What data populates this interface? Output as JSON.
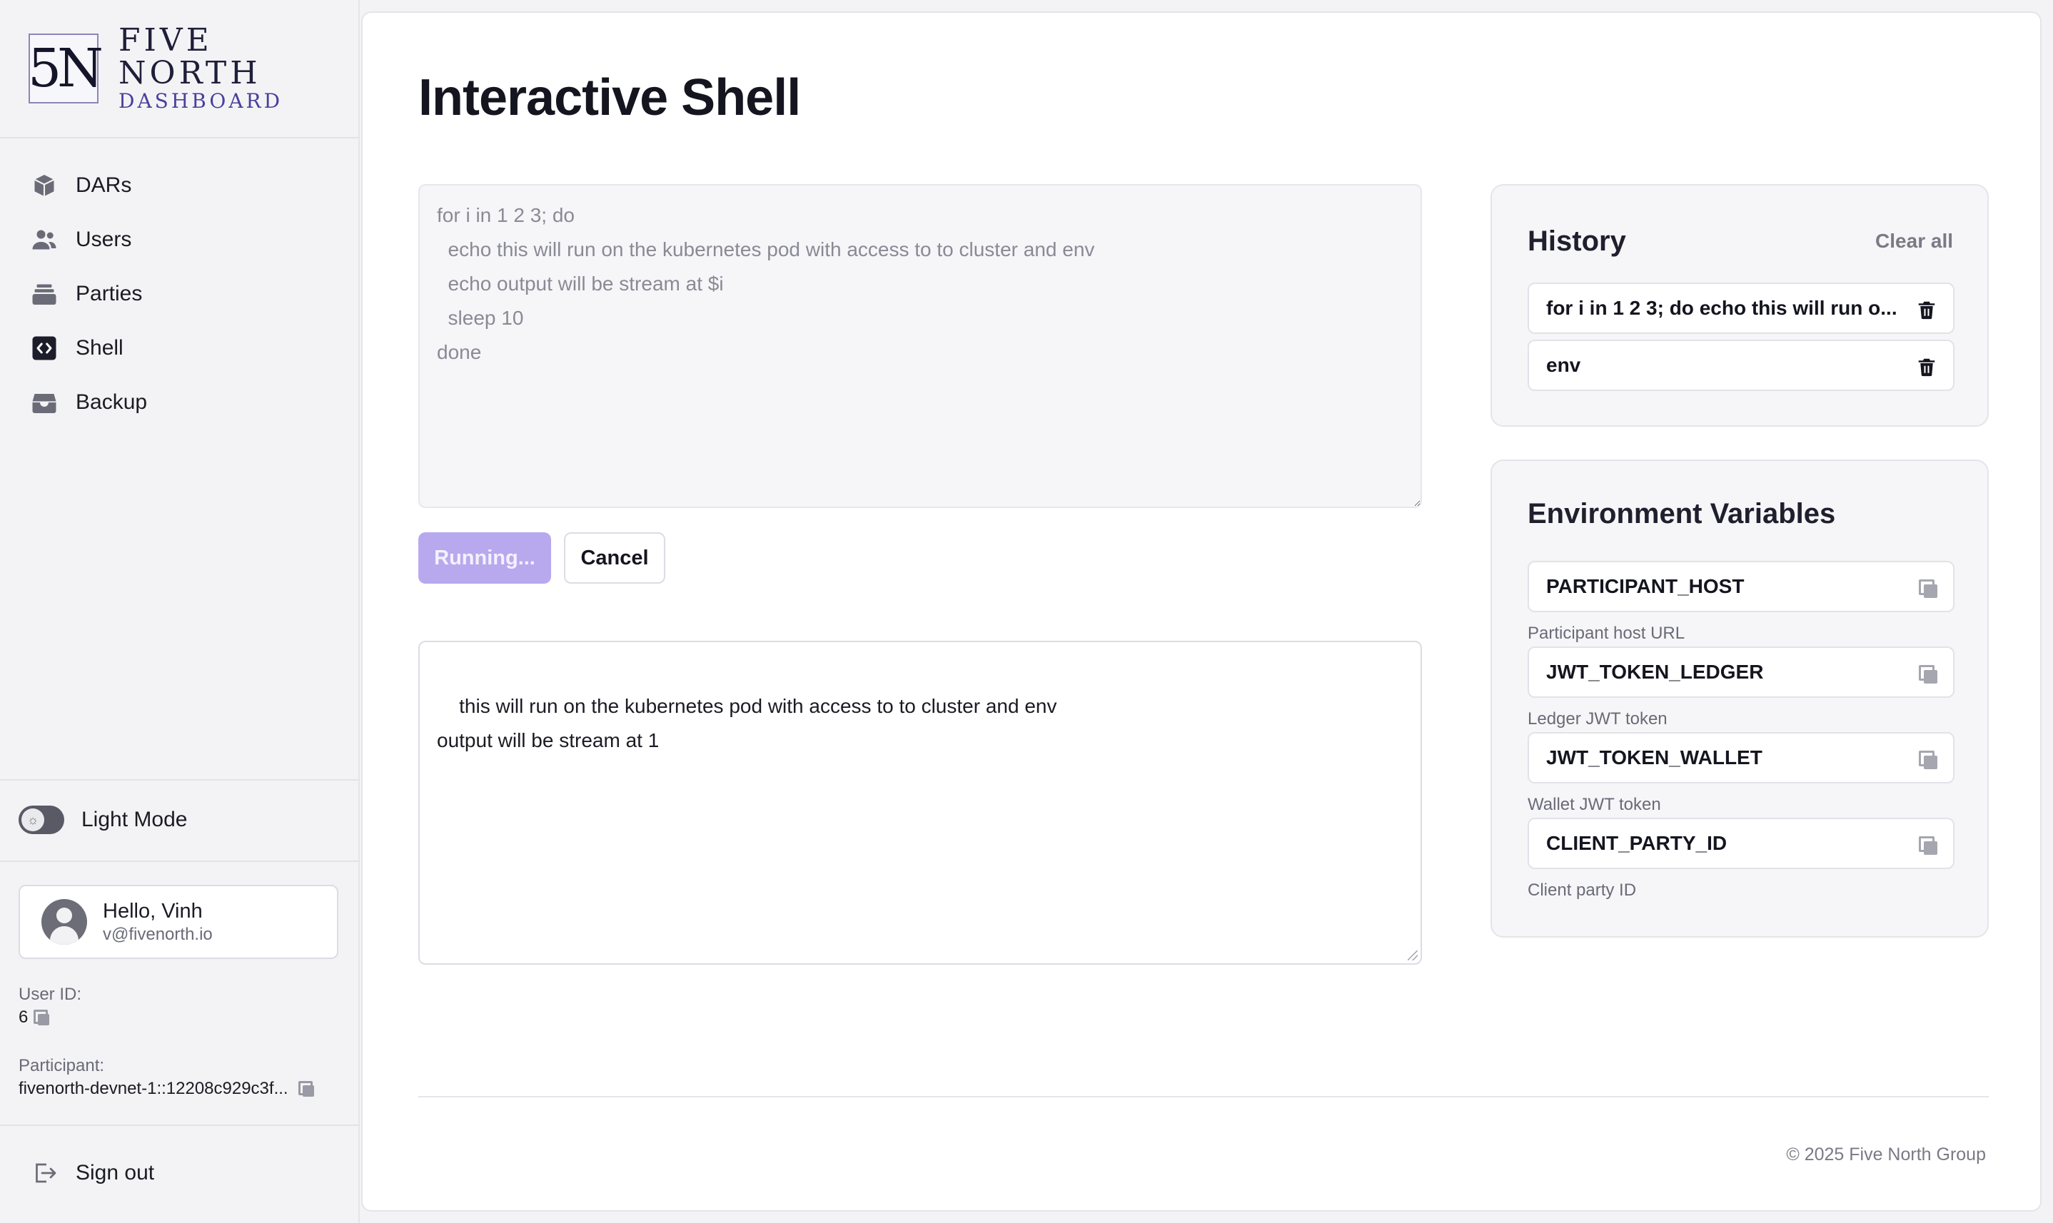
{
  "brand": {
    "logo_text": "5N",
    "name": "FIVE NORTH",
    "subtitle": "DASHBOARD"
  },
  "sidebar": {
    "items": [
      {
        "label": "DARs",
        "icon": "package-icon"
      },
      {
        "label": "Users",
        "icon": "users-icon"
      },
      {
        "label": "Parties",
        "icon": "parties-icon"
      },
      {
        "label": "Shell",
        "icon": "code-icon"
      },
      {
        "label": "Backup",
        "icon": "archive-icon"
      }
    ],
    "theme_label": "Light Mode",
    "user": {
      "hello": "Hello, Vinh",
      "email": "v@fivenorth.io"
    },
    "user_id_label": "User ID:",
    "user_id_value": "6",
    "participant_label": "Participant:",
    "participant_value": "fivenorth-devnet-1::12208c929c3f...",
    "signout_label": "Sign out"
  },
  "main": {
    "title": "Interactive Shell",
    "command_text": "for i in 1 2 3; do\n  echo this will run on the kubernetes pod with access to to cluster and env\n  echo output will be stream at $i\n  sleep 10\ndone",
    "run_label": "Running...",
    "cancel_label": "Cancel",
    "output_text": "this will run on the kubernetes pod with access to to cluster and env\noutput will be stream at 1"
  },
  "history": {
    "title": "History",
    "clear_label": "Clear all",
    "items": [
      "for i in 1 2 3; do echo this will run o...",
      "env"
    ]
  },
  "env": {
    "title": "Environment Variables",
    "vars": [
      {
        "name": "PARTICIPANT_HOST",
        "desc": "Participant host URL"
      },
      {
        "name": "JWT_TOKEN_LEDGER",
        "desc": "Ledger JWT token"
      },
      {
        "name": "JWT_TOKEN_WALLET",
        "desc": "Wallet JWT token"
      },
      {
        "name": "CLIENT_PARTY_ID",
        "desc": "Client party ID"
      }
    ]
  },
  "footer": {
    "text": "© 2025 Five North Group"
  },
  "colors": {
    "accent_disabled": "#b8a9ee",
    "brand_purple": "#4b3f9c"
  }
}
